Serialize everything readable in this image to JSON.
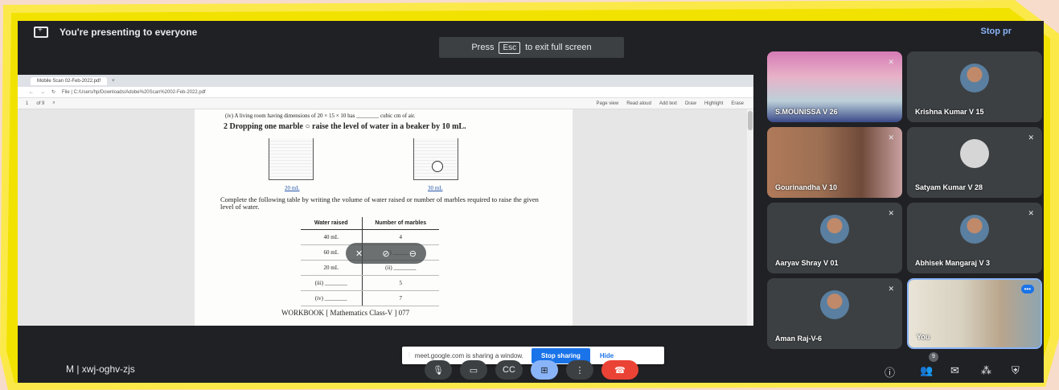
{
  "banner": {
    "presenting_text": "You're presenting to everyone",
    "stop_label": "Stop pr"
  },
  "toast": {
    "pre": "Press",
    "key": "Esc",
    "post": "to exit full screen"
  },
  "browser": {
    "tab_title": "Mobile Scan 02-Feb-2022.pdf",
    "address": "File  |  C:/Users/hp/Downloads/Adobe%20Scan%2002-Feb-2022.pdf",
    "page_box": "1",
    "page_of": "of 9",
    "tools": [
      "Page view",
      "Read aloud",
      "Add text",
      "Draw",
      "Highlight",
      "Erase"
    ]
  },
  "worksheet": {
    "line1": "(iv) A living room having dimensions of 20 × 15 × 10 has ________ cubic cm of air.",
    "q2": "2  Dropping one marble ○ raise the level of water in a beaker by 10 mL.",
    "beaker1_label": "20 mL",
    "beaker2_label": "30 mL",
    "instruction": "Complete the following table by writing the volume of water raised or number of marbles required to raise the given level of water.",
    "table": {
      "headers": [
        "Water raised",
        "Number of marbles"
      ],
      "rows": [
        [
          "40 mL",
          "4"
        ],
        [
          "60 mL",
          "(i) ________"
        ],
        [
          "20 mL",
          "(ii) ________"
        ],
        [
          "(iii) ________",
          "5"
        ],
        [
          "(iv) ________",
          "7"
        ]
      ]
    },
    "footer": "WORKBOOK  [ Mathematics Class-V ]  077"
  },
  "participants": [
    {
      "name": "S.MOUNISSA V 26",
      "kind": "video1"
    },
    {
      "name": "Krishna Kumar V 15",
      "kind": "photo"
    },
    {
      "name": "Gourinandha V 10",
      "kind": "video2"
    },
    {
      "name": "Satyam Kumar V 28",
      "kind": "plain"
    },
    {
      "name": "Aaryav Shray V 01",
      "kind": "photo"
    },
    {
      "name": "Abhisek Mangaraj V 3",
      "kind": "photo"
    },
    {
      "name": "Aman Raj-V-6",
      "kind": "photo"
    },
    {
      "name": "You",
      "kind": "video3"
    }
  ],
  "share_notice": {
    "text": "meet.google.com is sharing a window.",
    "stop": "Stop sharing",
    "hide": "Hide"
  },
  "bottom": {
    "meeting_code": "M  |  xwj-oghv-zjs",
    "people_count": "9"
  },
  "colors": {
    "frame": "#f5e400",
    "meet_bg": "#202124",
    "accent": "#1a73e8",
    "hangup": "#ea4335"
  }
}
